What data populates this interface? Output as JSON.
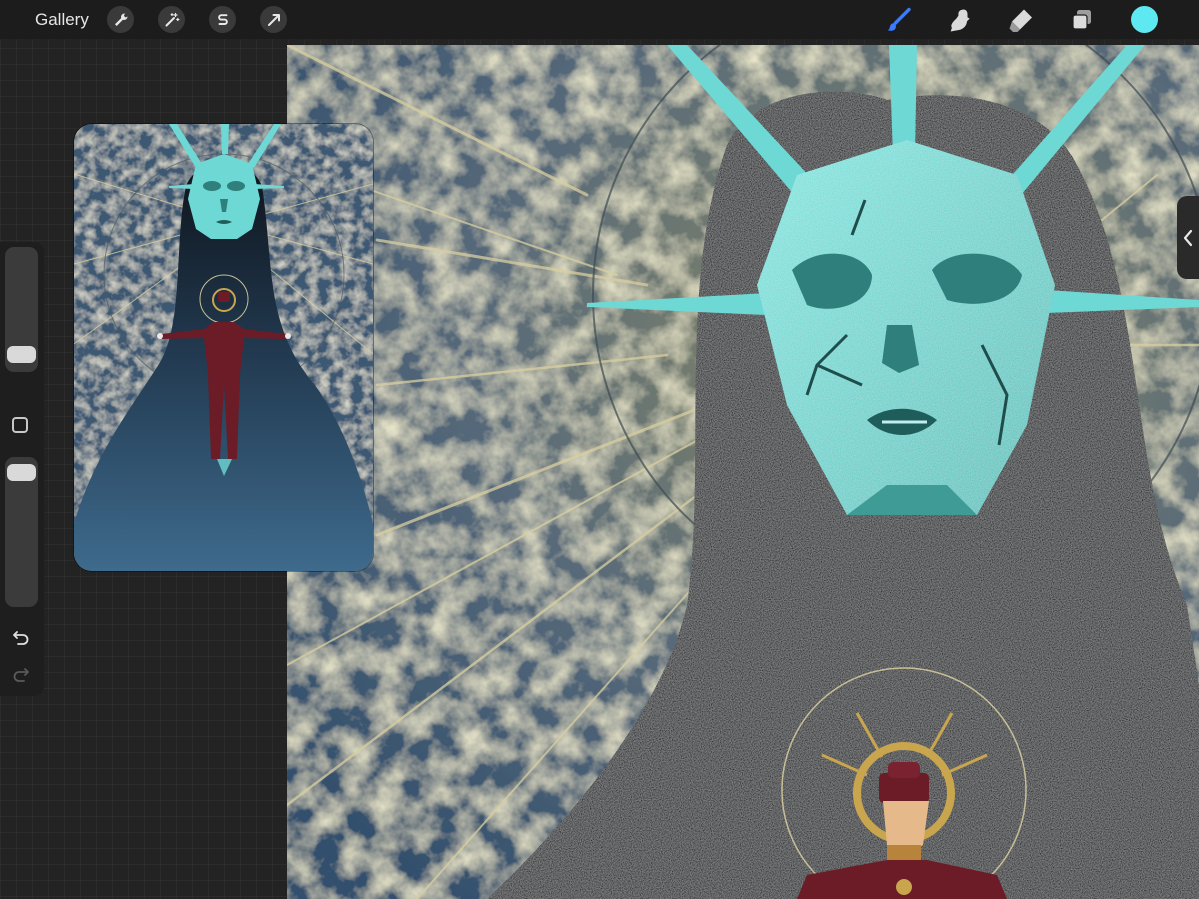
{
  "toolbar": {
    "gallery_label": "Gallery",
    "left_tools": [
      {
        "name": "actions",
        "icon": "wrench-icon"
      },
      {
        "name": "adjustments",
        "icon": "magic-wand-icon"
      },
      {
        "name": "selection",
        "icon": "selection-s-icon"
      },
      {
        "name": "transform",
        "icon": "arrow-cursor-icon"
      }
    ],
    "right_tools": [
      {
        "name": "brush",
        "icon": "brush-icon",
        "active": true
      },
      {
        "name": "smudge",
        "icon": "smudge-finger-icon",
        "active": false
      },
      {
        "name": "eraser",
        "icon": "eraser-icon",
        "active": false
      },
      {
        "name": "layers",
        "icon": "layers-icon",
        "active": false
      }
    ],
    "current_color": "#5ee8f2",
    "active_tool_color": "#3a7bff"
  },
  "sidebar": {
    "brush_size_level": 0.07,
    "opacity_level": 0.96,
    "modify_button_icon": "square-icon",
    "undo_icon": "undo-arrow-icon",
    "redo_icon": "redo-arrow-icon"
  },
  "palette": {
    "mask": "#6ed8d4",
    "mask_shadow": "#2f7f7c",
    "hair": "#0e141b",
    "sky_blue": "#3d5873",
    "sky_gold": "#8b8a64",
    "robe_blue": "#2d4d6a",
    "uniform": "#6b1c27",
    "halo_gold": "#c9a64e"
  },
  "reference_window": {
    "icon": "reference-image"
  },
  "edge_tab_icon": "chevron-left-icon"
}
